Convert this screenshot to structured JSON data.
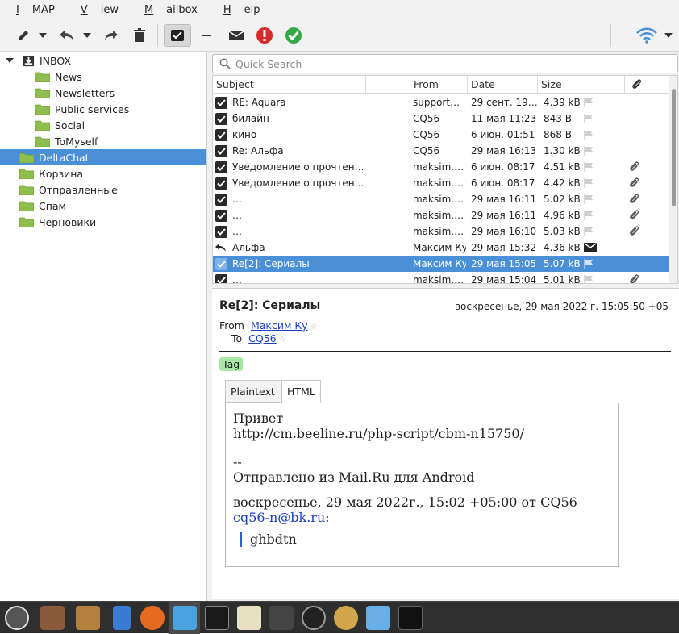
{
  "menu": {
    "items": [
      {
        "underline": "I",
        "rest": "MAP"
      },
      {
        "underline": "V",
        "rest": "iew"
      },
      {
        "underline": "M",
        "rest": "ailbox"
      },
      {
        "underline": "H",
        "rest": "elp"
      }
    ]
  },
  "toolbar": {
    "icons": [
      "compose-icon",
      "reply-icon",
      "forward-icon",
      "delete-icon",
      "mark-read-icon",
      "collapse-icon",
      "mark-unread-icon",
      "important-icon",
      "check-icon",
      "network-icon"
    ]
  },
  "folders": [
    {
      "name": "INBOX",
      "level": 0,
      "expanded": true
    },
    {
      "name": "News",
      "level": 1
    },
    {
      "name": "Newsletters",
      "level": 1
    },
    {
      "name": "Public services",
      "level": 1
    },
    {
      "name": "Social",
      "level": 1
    },
    {
      "name": "ToMyself",
      "level": 1
    },
    {
      "name": "DeltaChat",
      "level": 0,
      "selected": true
    },
    {
      "name": "Корзина",
      "level": 0
    },
    {
      "name": "Отправленные",
      "level": 0
    },
    {
      "name": "Спам",
      "level": 0
    },
    {
      "name": "Черновики",
      "level": 0
    }
  ],
  "search": {
    "placeholder": "Quick Search"
  },
  "list": {
    "columns": {
      "subject": "Subject",
      "from": "From",
      "date": "Date",
      "size": "Size"
    },
    "rows": [
      {
        "status": "check",
        "subject": "RE: Aquara",
        "from": "support…",
        "date": "29 сент. 19…",
        "size": "4.39 kB",
        "attach": false
      },
      {
        "status": "check",
        "subject": "билайн",
        "from": "CQ56",
        "date": "11 мая 11:23",
        "size": "843 B",
        "attach": false
      },
      {
        "status": "check",
        "subject": "кино",
        "from": "CQ56",
        "date": "6 июн. 01:51",
        "size": "868 B",
        "attach": false
      },
      {
        "status": "check",
        "subject": "Re: Альфа",
        "from": "CQ56",
        "date": "29 мая 16:13",
        "size": "1.30 kB",
        "attach": false
      },
      {
        "status": "check",
        "subject": "Уведомление о прочтен…",
        "from": "maksim.…",
        "date": "6 июн. 08:17",
        "size": "4.51 kB",
        "attach": true
      },
      {
        "status": "check",
        "subject": "Уведомление о прочтен…",
        "from": "maksim.…",
        "date": "6 июн. 08:17",
        "size": "4.42 kB",
        "attach": true
      },
      {
        "status": "check",
        "subject": "…",
        "from": "maksim.…",
        "date": "29 мая 16:11",
        "size": "5.02 kB",
        "attach": true
      },
      {
        "status": "check",
        "subject": "…",
        "from": "maksim.…",
        "date": "29 мая 16:11",
        "size": "4.96 kB",
        "attach": true
      },
      {
        "status": "check",
        "subject": "…",
        "from": "maksim.…",
        "date": "29 мая 16:10",
        "size": "5.03 kB",
        "attach": true
      },
      {
        "status": "reply",
        "subject": "Альфа",
        "from": "Максим Ку",
        "date": "29 мая 15:32",
        "size": "4.36 kB",
        "attach": false,
        "mail": true
      },
      {
        "status": "check",
        "subject": "Re[2]: Сериалы",
        "from": "Максим Ку",
        "date": "29 мая 15:05",
        "size": "5.07 kB",
        "attach": false,
        "selected": true
      },
      {
        "status": "check",
        "subject": "…",
        "from": "maksim.…",
        "date": "29 мая 15:04",
        "size": "5.01 kB",
        "attach": true
      }
    ]
  },
  "message": {
    "subject": "Re[2]: Сериалы",
    "date": "воскресенье, 29 мая 2022 г. 15:05:50 +05",
    "from_label": "From",
    "from": "Максим Ку",
    "to_label": "To",
    "to": "CQ56",
    "tag": "Tag",
    "tabs": [
      "Plaintext",
      "HTML"
    ],
    "active_tab": "HTML",
    "body": {
      "line1": "Привет",
      "line2": "http://cm.beeline.ru/php-script/cbm-n15750/",
      "line3": "--",
      "line4": "Отправлено из Mail.Ru для Android",
      "line5": "воскресенье, 29 мая 2022г., 15:02 +05:00 от CQ56",
      "email": "cq56-n@bk.ru",
      "colon": ":",
      "quote": "ghbdtn"
    }
  },
  "colors": {
    "accent": "#4a90d9",
    "folder": "#8fbe4f",
    "link": "#1a3ec7"
  }
}
